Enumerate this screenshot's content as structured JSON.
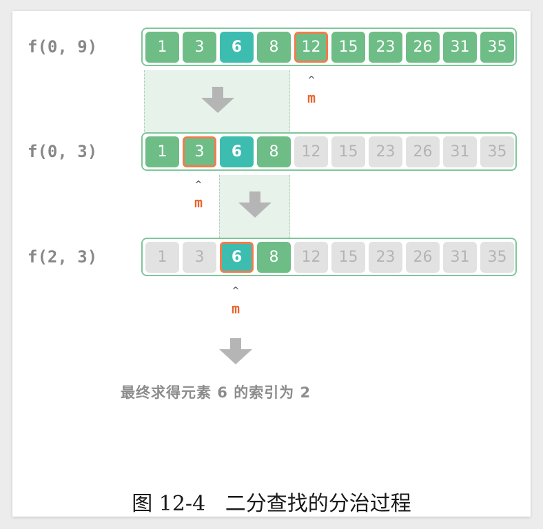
{
  "values": [
    "1",
    "3",
    "6",
    "8",
    "12",
    "15",
    "23",
    "26",
    "31",
    "35"
  ],
  "target_value": "6",
  "pointer_label": "m",
  "pointer_caret": "^",
  "steps": [
    {
      "call": "f(0, 9)",
      "low": 0,
      "high": 9,
      "mid": 4
    },
    {
      "call": "f(0, 3)",
      "low": 0,
      "high": 3,
      "mid": 1
    },
    {
      "call": "f(2, 3)",
      "low": 2,
      "high": 3,
      "mid": 2
    }
  ],
  "result_text": "最终求得元素 6 的索引为 2",
  "caption": "图 12-4   二分查找的分治过程",
  "colors": {
    "active_cell": "#6ebd87",
    "target_cell": "#3cbdb0",
    "inactive_cell": "#e2e2e2",
    "mid_border": "#ee7e4e",
    "pointer_text": "#e8642c",
    "frame_border": "#7ec699",
    "arrow": "#b5b5b5"
  }
}
